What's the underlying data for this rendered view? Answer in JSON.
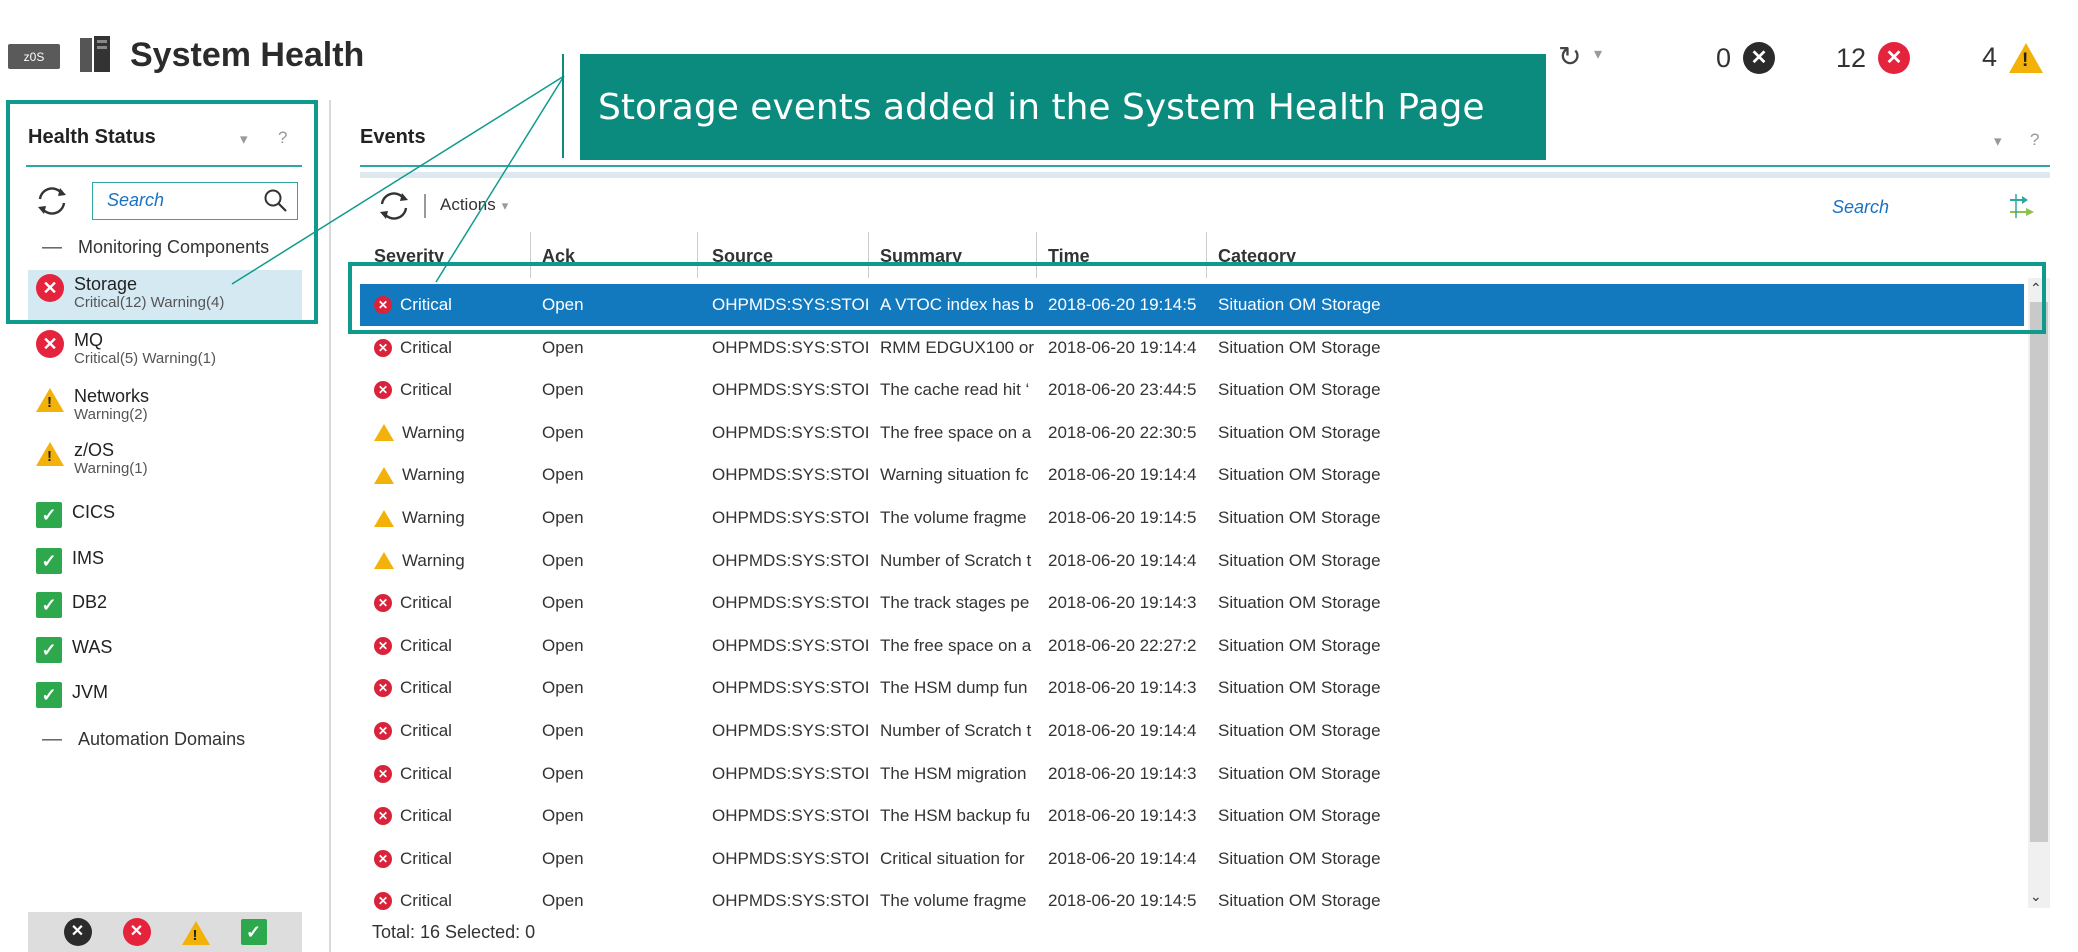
{
  "header": {
    "badge": "z0S",
    "title": "System Health",
    "counts": [
      {
        "value": "0",
        "kind": "black"
      },
      {
        "value": "12",
        "kind": "red"
      },
      {
        "value": "4",
        "kind": "warning"
      }
    ]
  },
  "callout": {
    "text": "Storage events added in the System Health Page"
  },
  "health_status": {
    "title": "Health Status",
    "help": "?",
    "search_placeholder": "Search",
    "group_monitoring": "Monitoring Components",
    "group_automation": "Automation Domains",
    "items": [
      {
        "name": "Storage",
        "sub": "Critical(12) Warning(4)",
        "status": "critical"
      },
      {
        "name": "MQ",
        "sub": "Critical(5) Warning(1)",
        "status": "critical"
      },
      {
        "name": "Networks",
        "sub": "Warning(2)",
        "status": "warning"
      },
      {
        "name": "z/OS",
        "sub": "Warning(1)",
        "status": "warning"
      },
      {
        "name": "CICS",
        "sub": "",
        "status": "ok"
      },
      {
        "name": "IMS",
        "sub": "",
        "status": "ok"
      },
      {
        "name": "DB2",
        "sub": "",
        "status": "ok"
      },
      {
        "name": "WAS",
        "sub": "",
        "status": "ok"
      },
      {
        "name": "JVM",
        "sub": "",
        "status": "ok"
      }
    ]
  },
  "events": {
    "title": "Events",
    "help": "?",
    "actions_label": "Actions",
    "search_placeholder": "Search",
    "columns": [
      "Severity",
      "Ack",
      "Source",
      "Summary",
      "Time",
      "Category"
    ],
    "rows": [
      {
        "severity": "Critical",
        "ack": "Open",
        "source": "OHPMDS:SYS:STOI",
        "summary": "A VTOC index has b",
        "time": "2018-06-20 19:14:5",
        "category": "Situation OM Storage"
      },
      {
        "severity": "Critical",
        "ack": "Open",
        "source": "OHPMDS:SYS:STOI",
        "summary": "RMM EDGUX100 or",
        "time": "2018-06-20 19:14:4",
        "category": "Situation OM Storage"
      },
      {
        "severity": "Critical",
        "ack": "Open",
        "source": "OHPMDS:SYS:STOI",
        "summary": "The cache read hit ‘",
        "time": "2018-06-20 23:44:5",
        "category": "Situation OM Storage"
      },
      {
        "severity": "Warning",
        "ack": "Open",
        "source": "OHPMDS:SYS:STOI",
        "summary": "The free space on a",
        "time": "2018-06-20 22:30:5",
        "category": "Situation OM Storage"
      },
      {
        "severity": "Warning",
        "ack": "Open",
        "source": "OHPMDS:SYS:STOI",
        "summary": "Warning situation fc",
        "time": "2018-06-20 19:14:4",
        "category": "Situation OM Storage"
      },
      {
        "severity": "Warning",
        "ack": "Open",
        "source": "OHPMDS:SYS:STOI",
        "summary": "The volume fragme",
        "time": "2018-06-20 19:14:5",
        "category": "Situation OM Storage"
      },
      {
        "severity": "Warning",
        "ack": "Open",
        "source": "OHPMDS:SYS:STOI",
        "summary": "Number of Scratch t",
        "time": "2018-06-20 19:14:4",
        "category": "Situation OM Storage"
      },
      {
        "severity": "Critical",
        "ack": "Open",
        "source": "OHPMDS:SYS:STOI",
        "summary": "The track stages pe",
        "time": "2018-06-20 19:14:3",
        "category": "Situation OM Storage"
      },
      {
        "severity": "Critical",
        "ack": "Open",
        "source": "OHPMDS:SYS:STOI",
        "summary": "The free space on a",
        "time": "2018-06-20 22:27:2",
        "category": "Situation OM Storage"
      },
      {
        "severity": "Critical",
        "ack": "Open",
        "source": "OHPMDS:SYS:STOI",
        "summary": "The HSM dump fun",
        "time": "2018-06-20 19:14:3",
        "category": "Situation OM Storage"
      },
      {
        "severity": "Critical",
        "ack": "Open",
        "source": "OHPMDS:SYS:STOI",
        "summary": "Number of Scratch t",
        "time": "2018-06-20 19:14:4",
        "category": "Situation OM Storage"
      },
      {
        "severity": "Critical",
        "ack": "Open",
        "source": "OHPMDS:SYS:STOI",
        "summary": "The HSM migration",
        "time": "2018-06-20 19:14:3",
        "category": "Situation OM Storage"
      },
      {
        "severity": "Critical",
        "ack": "Open",
        "source": "OHPMDS:SYS:STOI",
        "summary": "The HSM backup fu",
        "time": "2018-06-20 19:14:3",
        "category": "Situation OM Storage"
      },
      {
        "severity": "Critical",
        "ack": "Open",
        "source": "OHPMDS:SYS:STOI",
        "summary": "Critical situation for",
        "time": "2018-06-20 19:14:4",
        "category": "Situation OM Storage"
      },
      {
        "severity": "Critical",
        "ack": "Open",
        "source": "OHPMDS:SYS:STOI",
        "summary": "The volume fragme",
        "time": "2018-06-20 19:14:5",
        "category": "Situation OM Storage"
      }
    ],
    "selected_row": 0,
    "footer": "Total: 16 Selected: 0"
  },
  "colors": {
    "accent": "#0f9a8e",
    "selection": "#1279bf",
    "critical": "#e5233c",
    "warning": "#f2b20a",
    "ok": "#2ea84d"
  }
}
